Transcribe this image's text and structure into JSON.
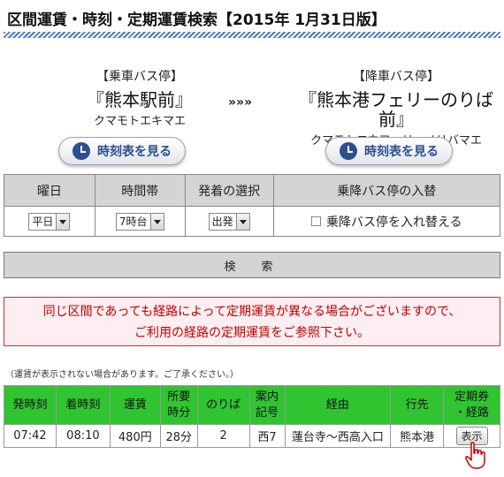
{
  "title": "区間運賃・時刻・定期運賃検索【2015年 1月31日版】",
  "from_stop": {
    "label": "【乗車バス停】",
    "name": "『熊本駅前』",
    "kana": "クマモトエキマエ",
    "timetable_button": "時刻表を見る"
  },
  "arrows": "»»»",
  "to_stop": {
    "label": "【降車バス停】",
    "name": "『熊本港フェリーのりば前』",
    "kana": "クマモトコウフェリーノリバマエ",
    "timetable_button": "時刻表を見る"
  },
  "options": {
    "headers": [
      "曜日",
      "時間帯",
      "発着の選択",
      "乗降バス停の入替"
    ],
    "weekday": "平日",
    "time_slot": "7時台",
    "direction": "出発",
    "swap_label": "乗降バス停を入れ替える"
  },
  "search_button": "検　索",
  "notice": {
    "line1": "同じ区間であっても経路によって定期運賃が異なる場合がございますので、",
    "line2": "ご利用の経路の定期運賃をご参照下さい。"
  },
  "small_note": "（運賃が表示されない場合があります。ご了承ください。）",
  "results": {
    "headers": {
      "depart": "発時刻",
      "arrive": "着時刻",
      "fare": "運賃",
      "duration_1": "所要",
      "duration_2": "時分",
      "platform": "のりば",
      "guide_1": "案内",
      "guide_2": "記号",
      "via": "経由",
      "dest": "行先",
      "pass_1": "定期券",
      "pass_2": "・経路"
    },
    "rows": [
      {
        "depart": "07:42",
        "arrive": "08:10",
        "fare": "480円",
        "duration": "28分",
        "platform": "2",
        "guide": "西7",
        "via": "蓮台寺～西高入口",
        "dest": "熊本港",
        "button": "表示"
      }
    ]
  },
  "colors": {
    "header_green": "#31c431",
    "notice_red": "#c00000",
    "accent_blue": "#2d4f8f"
  }
}
